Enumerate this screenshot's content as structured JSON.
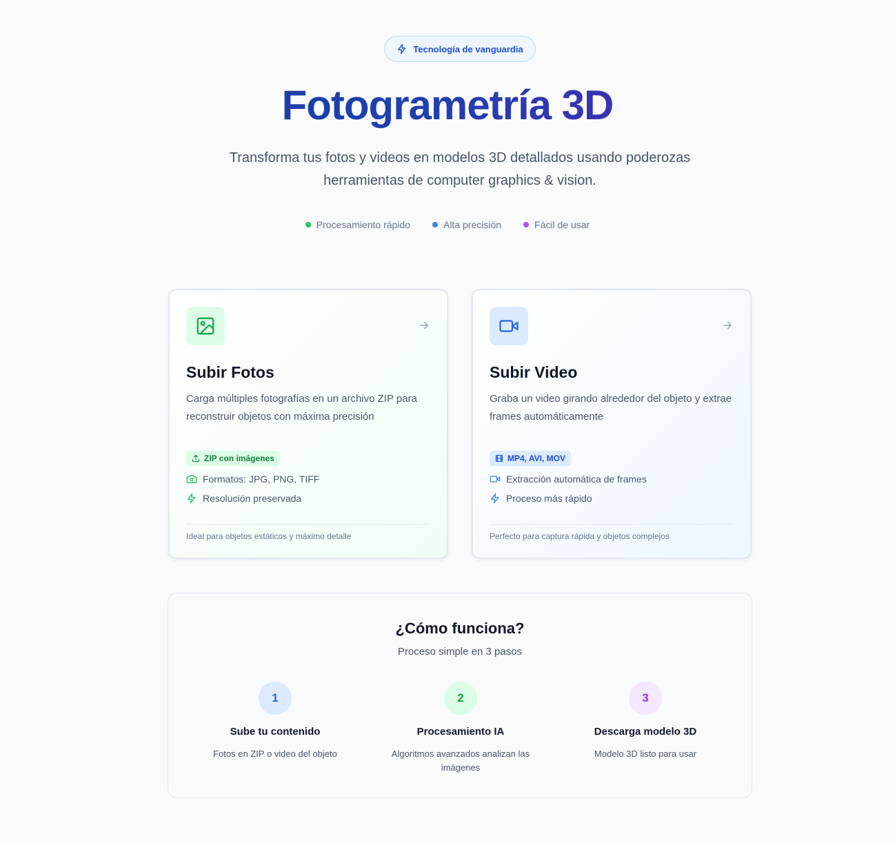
{
  "hero": {
    "badge": "Tecnología de vanguardia",
    "title": "Fotogrametría 3D",
    "subtitle": "Transforma tus fotos y videos en modelos 3D detallados usando poderozas herramientas de computer graphics & vision.",
    "features": [
      {
        "label": "Procesamiento rápido",
        "color": "#22c55e"
      },
      {
        "label": "Alta precisión",
        "color": "#3b82f6"
      },
      {
        "label": "Fácil de usar",
        "color": "#a855f7"
      }
    ]
  },
  "cards": {
    "photos": {
      "icon": "image-icon",
      "title": "Subir Fotos",
      "description": "Carga múltiples fotografías en un archivo ZIP para reconstruir objetos con máxima precisión",
      "pill": "ZIP con imágenes",
      "specs": [
        "Formatos: JPG, PNG, TIFF",
        "Resolución preservada"
      ],
      "footer": "Ideal para objetos estáticos y máximo detalle"
    },
    "video": {
      "icon": "video-icon",
      "title": "Subir Video",
      "description": "Graba un video girando alrededor del objeto y extrae frames automáticamente",
      "pill": "MP4, AVI, MOV",
      "specs": [
        "Extracción automática de frames",
        "Proceso más rápido"
      ],
      "footer": "Perfecto para captura rápida y objetos complejos"
    }
  },
  "how": {
    "title": "¿Cómo funciona?",
    "subtitle": "Proceso simple en 3 pasos",
    "steps": [
      {
        "num": "1",
        "title": "Sube tu contenido",
        "description": "Fotos en ZIP o video del objeto",
        "bg": "#dbeafe",
        "fg": "#2563eb"
      },
      {
        "num": "2",
        "title": "Procesamiento IA",
        "description": "Algoritmos avanzados analizan las imágenes",
        "bg": "#dcfce7",
        "fg": "#16a34a"
      },
      {
        "num": "3",
        "title": "Descarga modelo 3D",
        "description": "Modelo 3D listo para usar",
        "bg": "#f3e8ff",
        "fg": "#9333ea"
      }
    ]
  }
}
